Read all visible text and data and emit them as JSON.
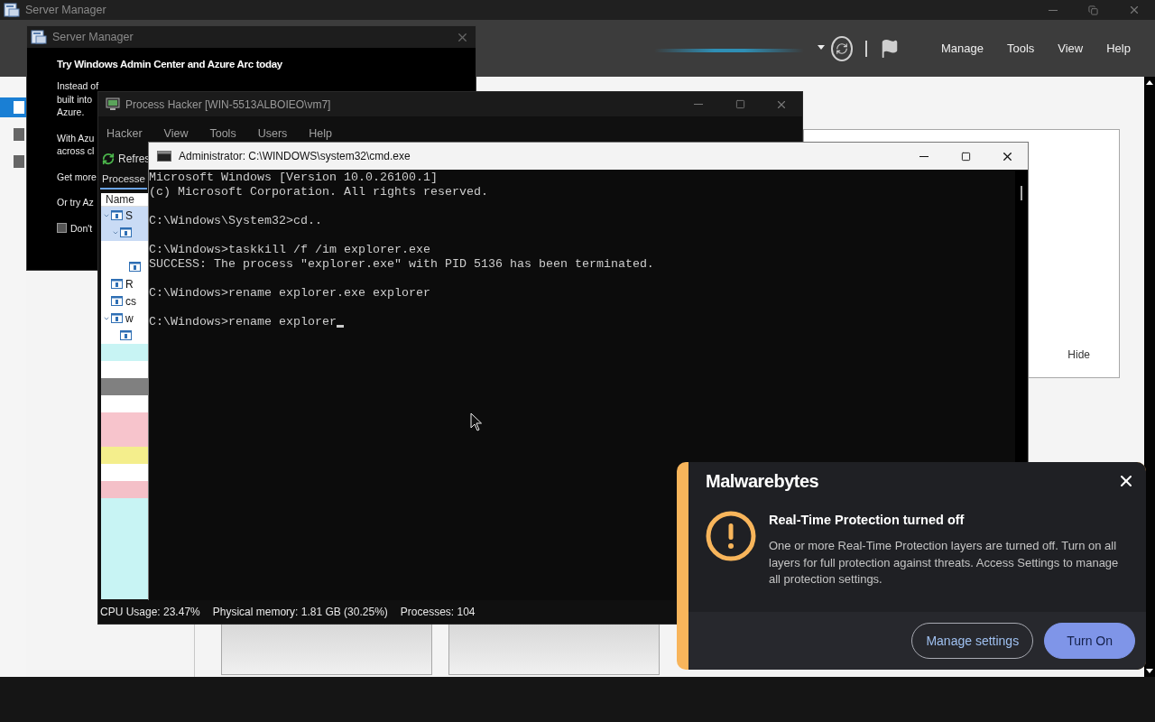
{
  "server_manager": {
    "title": "Server Manager",
    "menu": [
      "Manage",
      "Tools",
      "View",
      "Help"
    ],
    "nav": [
      {
        "selected": true
      },
      {
        "selected": false
      },
      {
        "selected": false
      }
    ],
    "hide_link": "Hide"
  },
  "dialog": {
    "title": "Server Manager",
    "heading": "Try Windows Admin Center and Azure Arc today",
    "paragraphs": [
      [
        "Instead of",
        "built into",
        "Azure."
      ],
      [
        "With Azu",
        "across cl"
      ],
      [
        "Get more"
      ],
      [
        "Or try Az"
      ]
    ],
    "checkbox": {
      "label": "Don't",
      "checked": false
    }
  },
  "process_hacker": {
    "title": "Process Hacker [WIN-5513ALBOIEO\\vm7]",
    "menu": [
      "Hacker",
      "View",
      "Tools",
      "Users",
      "Help"
    ],
    "refresh": "Refres",
    "tabs": [
      {
        "label": "Processe",
        "selected": true
      }
    ],
    "column": "Name",
    "rows": [
      {
        "kind": "process",
        "label": "S",
        "color": "#c9dbf5",
        "children": [
          {
            "kind": "process",
            "color": "#c9dbf5",
            "children": [
              {
                "kind": "empty",
                "color": "#ffffff"
              },
              {
                "kind": "process",
                "color": "#ffffff"
              }
            ]
          }
        ]
      },
      {
        "kind": "process",
        "label": "R",
        "color": "#ffffff"
      },
      {
        "kind": "process",
        "label": "cs",
        "color": "#ffffff"
      },
      {
        "kind": "process",
        "label": "w",
        "color": "#ffffff",
        "children": [
          {
            "kind": "process",
            "color": "#ffffff"
          }
        ]
      },
      {
        "kind": "empty",
        "color": "#c8f4f4"
      },
      {
        "kind": "empty",
        "color": "#ffffff"
      },
      {
        "kind": "empty",
        "color": "#808080"
      },
      {
        "kind": "empty",
        "color": "#ffffff"
      },
      {
        "kind": "empty",
        "color": "#f7c4cc"
      },
      {
        "kind": "empty",
        "color": "#f7c4cc"
      },
      {
        "kind": "empty",
        "color": "#f4ee8c"
      },
      {
        "kind": "empty",
        "color": "#ffffff"
      },
      {
        "kind": "empty",
        "color": "#f4c0c8"
      },
      {
        "kind": "empty",
        "color": "#c8f4f4"
      },
      {
        "kind": "empty",
        "color": "#c8f4f4"
      },
      {
        "kind": "empty",
        "color": "#c8f4f4"
      },
      {
        "kind": "empty",
        "color": "#c8f4f4"
      },
      {
        "kind": "empty",
        "color": "#c8f4f4"
      },
      {
        "kind": "empty",
        "color": "#c8f4f4"
      }
    ],
    "status": [
      "CPU Usage: 23.47%",
      "Physical memory: 1.81 GB (30.25%)",
      "Processes: 104"
    ]
  },
  "cmd": {
    "title": "Administrator: C:\\WINDOWS\\system32\\cmd.exe",
    "blocks": [
      [
        "Microsoft Windows [Version 10.0.26100.1]",
        "(c) Microsoft Corporation. All rights reserved."
      ],
      [
        "C:\\Windows\\System32>cd.."
      ],
      [
        "C:\\Windows>taskkill /f /im explorer.exe",
        "SUCCESS: The process \"explorer.exe\" with PID 5136 has been terminated."
      ],
      [
        "C:\\Windows>rename explorer.exe explorer"
      ],
      [
        "C:\\Windows>rename explorer"
      ]
    ]
  },
  "notification": {
    "brand": "Malwarebytes",
    "title": "Real-Time Protection turned off",
    "message": "One or more Real-Time Protection layers are turned off. Turn on all layers for full protection against threats. Access Settings to manage all protection settings.",
    "buttons": [
      {
        "label": "Manage settings",
        "kind": "secondary"
      },
      {
        "label": "Turn On",
        "kind": "primary"
      }
    ]
  }
}
